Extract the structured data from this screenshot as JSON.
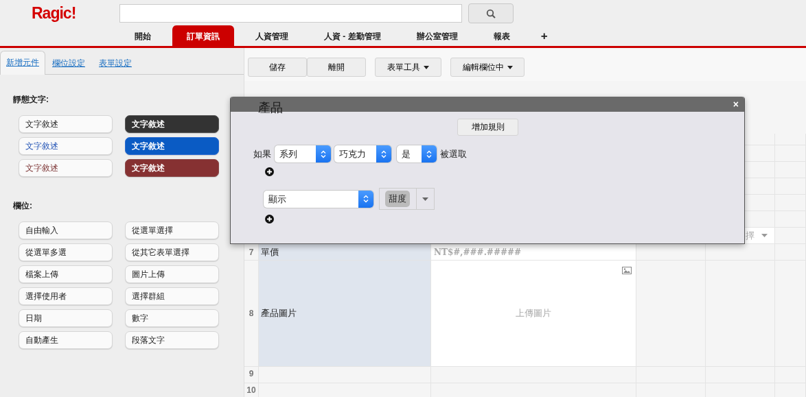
{
  "header": {
    "logo": "Ragic!",
    "tabs": [
      {
        "label": "開始",
        "selected": false
      },
      {
        "label": "訂單資訊",
        "selected": true
      },
      {
        "label": "人資管理",
        "selected": false
      },
      {
        "label": "人資 - 差勤管理",
        "selected": false
      },
      {
        "label": "辦公室管理",
        "selected": false
      },
      {
        "label": "報表",
        "selected": false
      }
    ],
    "add_tab": "+"
  },
  "sidebar": {
    "tabs": [
      {
        "label": "新增元件",
        "selected": true
      },
      {
        "label": "欄位設定",
        "selected": false
      },
      {
        "label": "表單設定",
        "selected": false
      }
    ],
    "static_heading": "靜態文字:",
    "static_items": [
      {
        "label": "文字敘述",
        "kind": "plain"
      },
      {
        "label": "文字敘述",
        "kind": "dark"
      },
      {
        "label": "文字敘述",
        "kind": "blue-text"
      },
      {
        "label": "文字敘述",
        "kind": "blue"
      },
      {
        "label": "文字敘述",
        "kind": "red-text"
      },
      {
        "label": "文字敘述",
        "kind": "red"
      }
    ],
    "fields_heading": "欄位:",
    "field_items": [
      "自由輸入",
      "從選單選擇",
      "從選單多選",
      "從其它表單選擇",
      "檔案上傳",
      "圖片上傳",
      "選擇使用者",
      "選擇群組",
      "日期",
      "數字",
      "自動產生",
      "段落文字"
    ]
  },
  "toolbar": [
    {
      "label": "儲存",
      "dropdown": false
    },
    {
      "label": "離開",
      "dropdown": false
    },
    {
      "label": "表單工具",
      "dropdown": true
    },
    {
      "label": "編輯欄位中",
      "dropdown": true
    }
  ],
  "sheet": {
    "title": "產品",
    "partial_cell": "擇",
    "rows": [
      {
        "number": "7",
        "label": "單價",
        "value": "NT$#,###.#####",
        "kind": "text"
      },
      {
        "number": "8",
        "label": "產品圖片",
        "value": "上傳圖片",
        "kind": "image"
      },
      {
        "number": "9"
      },
      {
        "number": "10"
      }
    ]
  },
  "dialog": {
    "close": "×",
    "add_rule": "增加規則",
    "condition": {
      "prefix": "如果",
      "selects": [
        "系列",
        "巧克力",
        "是"
      ],
      "suffix": "被選取"
    },
    "action": {
      "select": "顯示",
      "tags": [
        "甜度"
      ]
    }
  }
}
